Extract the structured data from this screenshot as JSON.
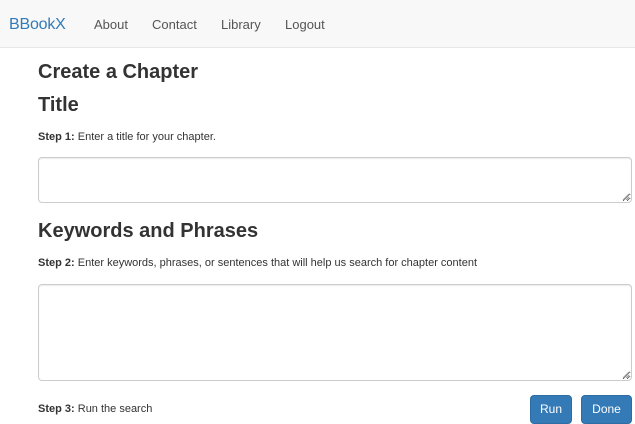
{
  "navbar": {
    "brand": "BBookX",
    "links": [
      {
        "label": "About"
      },
      {
        "label": "Contact"
      },
      {
        "label": "Library"
      },
      {
        "label": "Logout"
      }
    ]
  },
  "page": {
    "heading": "Create a Chapter"
  },
  "title_section": {
    "heading": "Title",
    "step_label": "Step 1:",
    "step_text": " Enter a title for your chapter.",
    "value": ""
  },
  "keywords_section": {
    "heading": "Keywords and Phrases",
    "step_label": "Step 2:",
    "step_text": " Enter keywords, phrases, or sentences that will help us search for chapter content",
    "value": ""
  },
  "search_section": {
    "step_label": "Step 3:",
    "step_text": " Run the search",
    "run_label": "Run",
    "done_label": "Done"
  },
  "colors": {
    "brand": "#337ab7",
    "navbar_bg": "#f8f8f8",
    "button_primary": "#337ab7",
    "text": "#333333"
  }
}
